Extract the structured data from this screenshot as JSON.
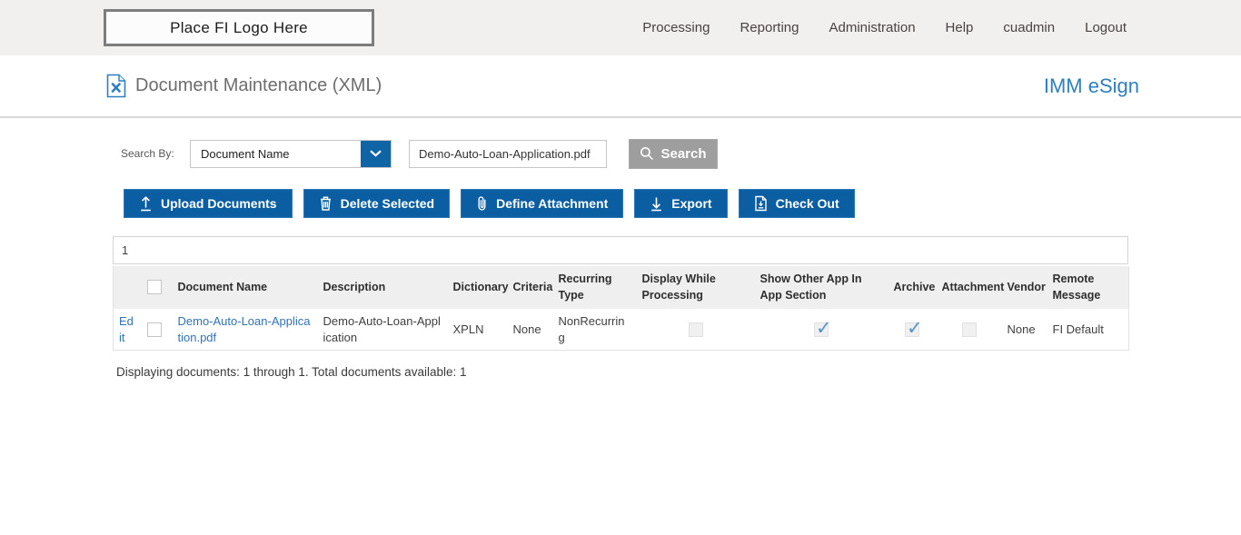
{
  "topbar": {
    "logo_text": "Place FI Logo Here",
    "nav": [
      "Processing",
      "Reporting",
      "Administration",
      "Help",
      "cuadmin",
      "Logout"
    ]
  },
  "header": {
    "title": "Document Maintenance (XML)",
    "title_icon": "document-x-icon",
    "brand": "IMM eSign"
  },
  "search": {
    "label": "Search By:",
    "dropdown_value": "Document Name",
    "dropdown_icon": "chevron-down-icon",
    "input_value": "Demo-Auto-Loan-Application.pdf",
    "button_label": "Search",
    "button_icon": "search-icon"
  },
  "actions": [
    {
      "label": "Upload Documents",
      "icon": "upload-icon"
    },
    {
      "label": "Delete Selected",
      "icon": "trash-icon"
    },
    {
      "label": "Define Attachment",
      "icon": "paperclip-icon"
    },
    {
      "label": "Export",
      "icon": "download-icon"
    },
    {
      "label": "Check Out",
      "icon": "checkout-document-icon"
    }
  ],
  "table": {
    "pagination": "1",
    "columns": [
      "Document Name",
      "Description",
      "Dictionary",
      "Criteria",
      "Recurring Type",
      "Display While Processing",
      "Show Other App In App Section",
      "Archive",
      "Attachment",
      "Vendor",
      "Remote Message"
    ],
    "rows": [
      {
        "edit_label": "Edit",
        "selected": false,
        "document_name": "Demo-Auto-Loan-Application.pdf",
        "description": "Demo-Auto-Loan-Application",
        "dictionary": "XPLN",
        "criteria": "None",
        "recurring_type": "NonRecurring",
        "display_while_processing": false,
        "show_other_app_in_app_section": true,
        "archive": true,
        "attachment": false,
        "vendor": "None",
        "remote_message": "FI Default"
      }
    ],
    "footer": "Displaying documents: 1 through 1. Total documents available: 1"
  },
  "colors": {
    "button_blue": "#0b5ea2",
    "dropdown_blue": "#0e64a4",
    "brand_blue": "#2e7fc1",
    "link_blue": "#3173b4",
    "check_blue": "#5b93c9",
    "search_button_gray": "#9e9e9e",
    "topbar_gray": "#f1f0ef",
    "table_header_gray": "#efefef"
  }
}
